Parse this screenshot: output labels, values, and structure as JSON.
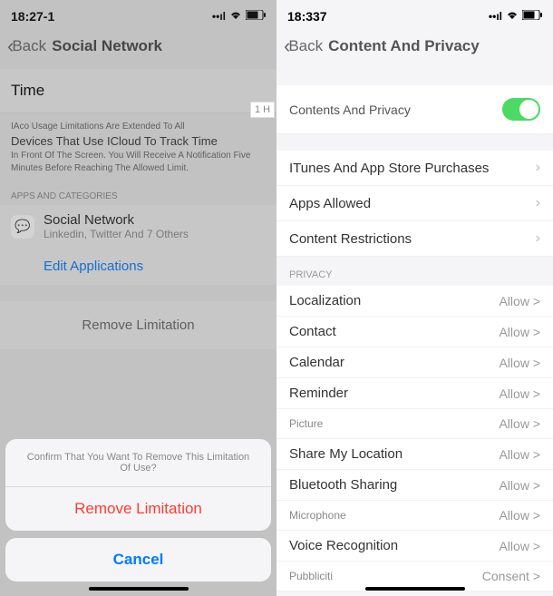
{
  "left": {
    "status": {
      "time": "18:27-1",
      "icons": "📶 📡 🔋"
    },
    "nav": {
      "back": "Back",
      "title": "Social Network"
    },
    "time_field": "Time",
    "desc_line1": "IAco Usage Limitations Are Extended To All",
    "desc_line2": "Devices That Use ICloud To Track Time",
    "desc_line3": "In Front Of The Screen. You Will Receive A Notification Five Minutes Before Reaching The Allowed Limit.",
    "apps_header": "APPS AND CATEGORIES",
    "app": {
      "title": "Social Network",
      "sub": "Linkedin, Twitter And 7 Others"
    },
    "edit": "Edit Applications",
    "remove_row": "Remove Limitation",
    "sheet": {
      "msg": "Confirm That You Want To Remove This Limitation Of Use?",
      "remove": "Remove Limitation",
      "cancel": "Cancel"
    }
  },
  "right": {
    "status": {
      "time": "18:337",
      "icons": "📶 📡 🔋"
    },
    "nav": {
      "back": "Back",
      "title": "Content And Privacy"
    },
    "toggle_label": "Contents And Privacy",
    "badge": "1 H",
    "items": [
      {
        "label": "ITunes And App Store Purchases"
      },
      {
        "label": "Apps Allowed"
      },
      {
        "label": "Content Restrictions"
      }
    ],
    "privacy_header": "PRIVACY",
    "privacy": [
      {
        "label": "Localization",
        "value": "Allow >"
      },
      {
        "label": "Contact",
        "value": "Allow >"
      },
      {
        "label": "Calendar",
        "value": "Allow >"
      },
      {
        "label": "Reminder",
        "value": "Allow >"
      },
      {
        "label": "Picture",
        "value": "Allow >",
        "small": true
      },
      {
        "label": "Share My Location",
        "value": "Allow >"
      },
      {
        "label": "Bluetooth Sharing",
        "value": "Allow >"
      },
      {
        "label": "Microphone",
        "value": "Allow >",
        "small": true
      },
      {
        "label": "Voice Recognition",
        "value": "Allow >"
      },
      {
        "label": "Pubbliciti",
        "value": "Consent >",
        "small": true
      }
    ]
  }
}
